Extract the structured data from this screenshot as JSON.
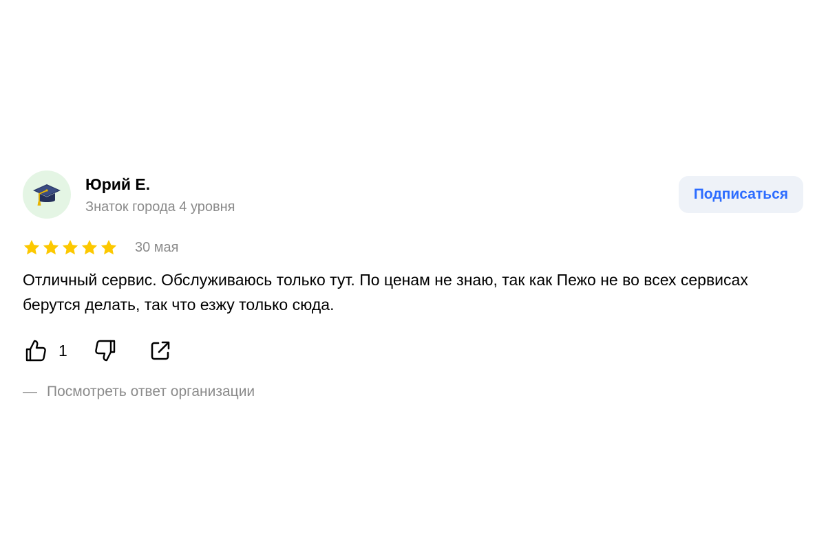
{
  "author": {
    "name": "Юрий Е.",
    "level": "Знаток города 4 уровня",
    "avatar_icon": "graduation-cap-icon"
  },
  "subscribe": {
    "label": "Подписаться"
  },
  "review": {
    "rating": 5,
    "rating_max": 5,
    "date": "30 мая",
    "text": "Отличный сервис. Обслуживаюсь только тут. По ценам не знаю, так как Пежо не во всех сервисах берутся делать, так что езжу только сюда."
  },
  "actions": {
    "like_icon": "thumbs-up-icon",
    "like_count": "1",
    "dislike_icon": "thumbs-down-icon",
    "share_icon": "share-icon"
  },
  "org_reply": {
    "dash": "—",
    "label": "Посмотреть ответ организации"
  },
  "colors": {
    "accent": "#2c6cff",
    "star": "#fcc800",
    "muted_text": "#8a8a8a",
    "avatar_bg": "#e4f5e4",
    "button_bg": "#eef2f8"
  }
}
